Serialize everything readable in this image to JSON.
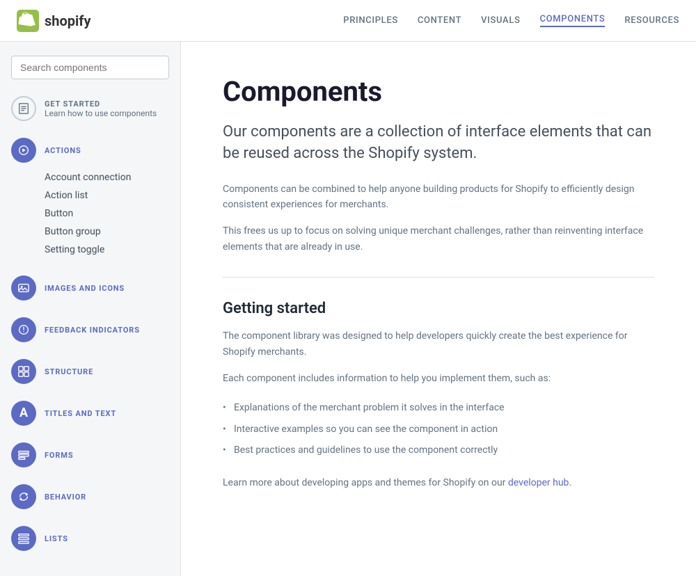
{
  "header": {
    "logo_text": "shopify",
    "nav_items": [
      {
        "label": "PRINCIPLES",
        "active": false
      },
      {
        "label": "CONTENT",
        "active": false
      },
      {
        "label": "VISUALS",
        "active": false
      },
      {
        "label": "COMPONENTS",
        "active": true
      },
      {
        "label": "RESOURCES",
        "active": false
      }
    ]
  },
  "sidebar": {
    "search_placeholder": "Search components",
    "groups": [
      {
        "id": "get-started",
        "icon": "📄",
        "label": "GET STARTED",
        "subtitle": "Learn how to use components",
        "items": []
      },
      {
        "id": "actions",
        "icon": "⚡",
        "label": "ACTIONS",
        "items": [
          "Account connection",
          "Action list",
          "Button",
          "Button group",
          "Setting toggle"
        ]
      },
      {
        "id": "images-icons",
        "icon": "🖼",
        "label": "IMAGES AND ICONS",
        "items": []
      },
      {
        "id": "feedback",
        "icon": "✳",
        "label": "FEEDBACK INDICATORS",
        "items": []
      },
      {
        "id": "structure",
        "icon": "▦",
        "label": "STRUCTURE",
        "items": []
      },
      {
        "id": "titles-text",
        "icon": "A",
        "label": "TITLES AND TEXT",
        "items": []
      },
      {
        "id": "forms",
        "icon": "▤",
        "label": "FORMS",
        "items": []
      },
      {
        "id": "behavior",
        "icon": "↺",
        "label": "BEHAVIOR",
        "items": []
      },
      {
        "id": "lists",
        "icon": "▤",
        "label": "LISTS",
        "items": []
      }
    ]
  },
  "main": {
    "title": "Components",
    "subtitle": "Our components are a collection of interface elements that can be reused across the Shopify system.",
    "desc1": "Components can be combined to help anyone building products for Shopify to efficiently design consistent experiences for merchants.",
    "desc2": "This frees us up to focus on solving unique merchant challenges, rather than reinventing interface elements that are already in use.",
    "getting_started_title": "Getting started",
    "getting_started_desc1": "The component library was designed to help developers quickly create the best experience for Shopify merchants.",
    "getting_started_desc2": "Each component includes information to help you implement them, such as:",
    "bullets": [
      "Explanations of the merchant problem it solves in the interface",
      "Interactive examples so you can see the component in action",
      "Best practices and guidelines to use the component correctly"
    ],
    "dev_link_text": "Learn more about developing apps and themes for Shopify on our ",
    "dev_link_label": "developer hub",
    "dev_link_suffix": "."
  }
}
